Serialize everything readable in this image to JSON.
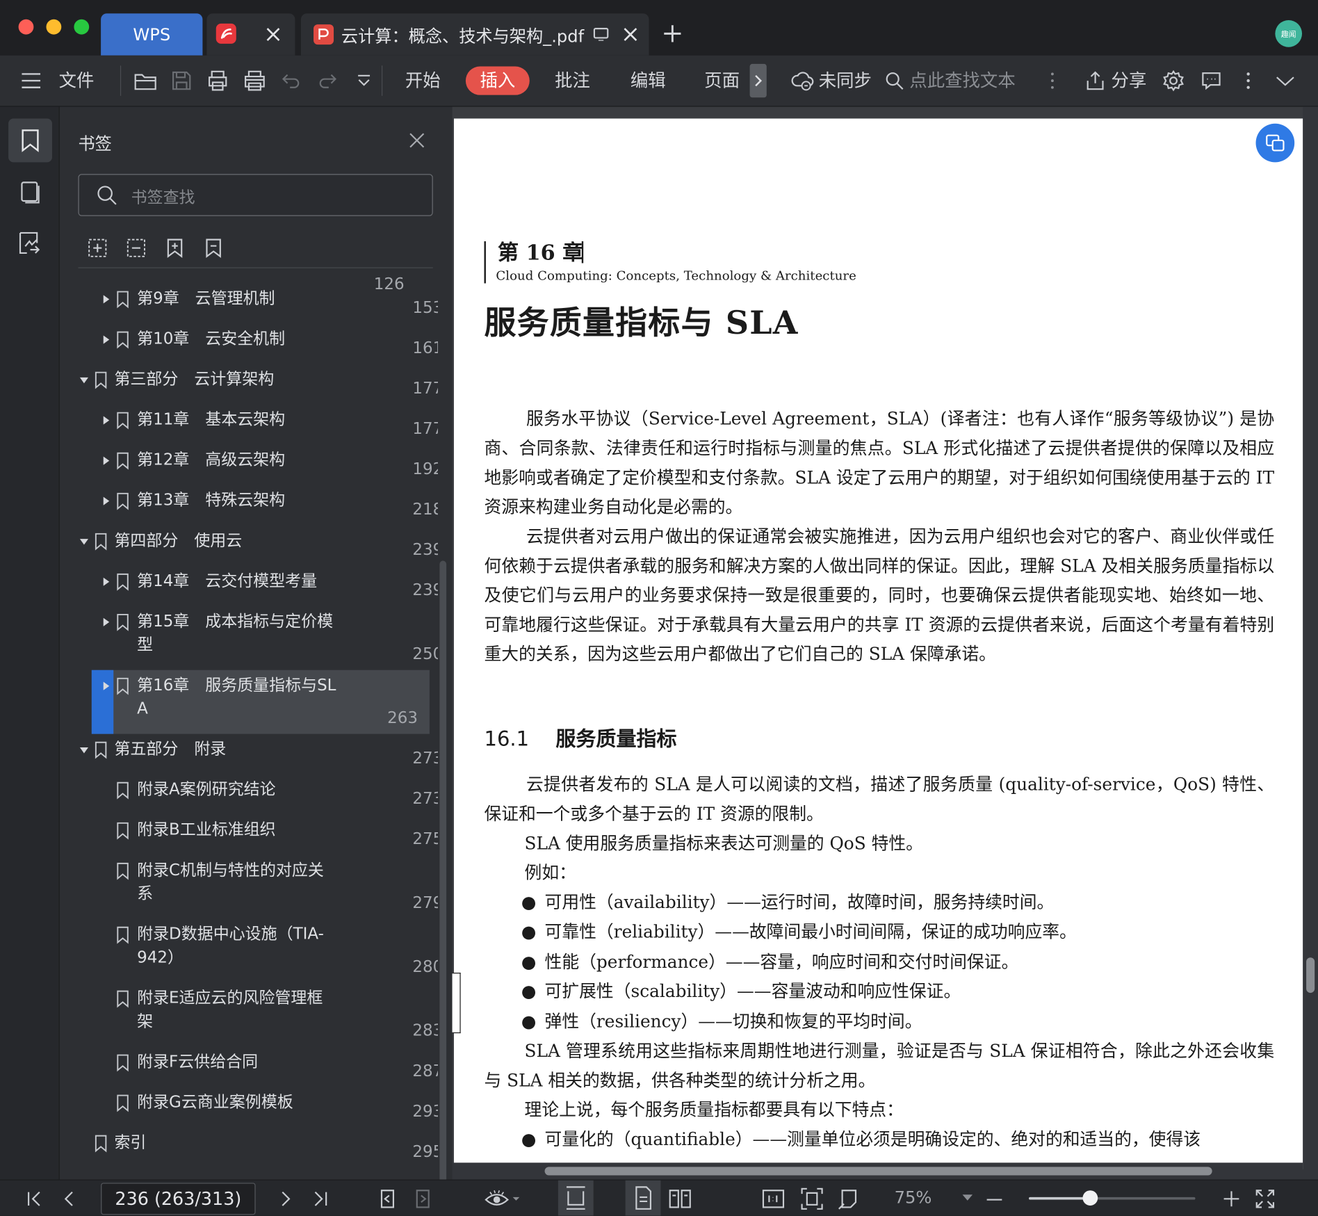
{
  "window": {
    "tabs": [
      {
        "label": "WPS"
      },
      {
        "label": "云计算：概念、技术与架构_.pdf"
      }
    ],
    "avatar_text": "趣闻"
  },
  "toolbar": {
    "file_label": "文件",
    "menu_tabs": [
      "开始",
      "插入",
      "批注",
      "编辑",
      "页面"
    ],
    "active_tab": "插入",
    "sync_label": "未同步",
    "search_placeholder": "点此查找文本",
    "share_label": "分享"
  },
  "sidebar": {
    "title": "书签",
    "search_placeholder": "书签查找",
    "partial_top_page": "126",
    "bookmarks": [
      {
        "label": "第9章　云管理机制",
        "page": "153"
      },
      {
        "label": "第10章　云安全机制",
        "page": "161"
      },
      {
        "label": "第三部分　云计算架构",
        "page": "177"
      },
      {
        "label": "第11章　基本云架构",
        "page": "177"
      },
      {
        "label": "第12章　高级云架构",
        "page": "192"
      },
      {
        "label": "第13章　特殊云架构",
        "page": "218"
      },
      {
        "label": "第四部分　使用云",
        "page": "239"
      },
      {
        "label": "第14章　云交付模型考量",
        "page": "239"
      },
      {
        "label_line1": "第15章　成本指标与定价模",
        "label_line2": "型",
        "page": "250"
      },
      {
        "label_line1": "第16章　服务质量指标与SL",
        "label_line2": "A",
        "page": "263"
      },
      {
        "label": "第五部分　附录",
        "page": "273"
      },
      {
        "label": "附录A案例研究结论",
        "page": "273"
      },
      {
        "label": "附录B工业标准组织",
        "page": "275"
      },
      {
        "label_line1": "附录C机制与特性的对应关",
        "label_line2": "系",
        "page": "279"
      },
      {
        "label_line1": "附录D数据中心设施（TIA-",
        "label_line2": "942）",
        "page": "280"
      },
      {
        "label_line1": "附录E适应云的风险管理框",
        "label_line2": "架",
        "page": "283"
      },
      {
        "label": "附录F云供给合同",
        "page": "287"
      },
      {
        "label": "附录G云商业案例模板",
        "page": "293"
      },
      {
        "label": "索引",
        "page": "295"
      }
    ]
  },
  "document": {
    "chapter_label": "第 16 章",
    "book_subtitle": "Cloud Computing: Concepts, Technology & Architecture",
    "chapter_title": "服务质量指标与 SLA",
    "p1": "服务水平协议（Service-Level Agreement，SLA）(译者注：也有人译作“服务等级协议”) 是协商、合同条款、法律责任和运行时指标与测量的焦点。SLA 形式化描述了云提供者提供的保障以及相应地影响或者确定了定价模型和支付条款。SLA 设定了云用户的期望，对于组织如何围绕使用基于云的 IT 资源来构建业务自动化是必需的。",
    "p2": "云提供者对云用户做出的保证通常会被实施推进，因为云用户组织也会对它的客户、商业伙伴或任何依赖于云提供者承载的服务和解决方案的人做出同样的保证。因此，理解 SLA 及相关服务质量指标以及使它们与云用户的业务要求保持一致是很重要的，同时，也要确保云提供者能现实地、始终如一地、可靠地履行这些保证。对于承载具有大量云用户的共享 IT 资源的云提供者来说，后面这个考量有着特别重大的关系，因为这些云用户都做出了它们自己的 SLA 保障承诺。",
    "section_number": "16.1",
    "section_title": "服务质量指标",
    "p3": "云提供者发布的 SLA 是人可以阅读的文档，描述了服务质量 (quality-of-service，QoS) 特性、保证和一个或多个基于云的 IT 资源的限制。",
    "p4": "SLA 使用服务质量指标来表达可测量的 QoS 特性。",
    "p5": "例如：",
    "bullets": [
      "可用性（availability）——运行时间，故障时间，服务持续时间。",
      "可靠性（reliability）——故障间最小时间间隔，保证的成功响应率。",
      "性能（performance）——容量，响应时间和交付时间保证。",
      "可扩展性（scalability）——容量波动和响应性保证。",
      "弹性（resiliency）——切换和恢复的平均时间。"
    ],
    "p6": "SLA 管理系统用这些指标来周期性地进行测量，验证是否与 SLA 保证相符合，除此之外还会收集与 SLA 相关的数据，供各种类型的统计分析之用。",
    "p7": "理论上说，每个服务质量指标都要具有以下特点：",
    "bullet_last": "可量化的（quantifiable）——测量单位必须是明确设定的、绝对的和适当的，使得该"
  },
  "statusbar": {
    "page_indicator": "236 (263/313)",
    "zoom": "75%",
    "zoom_level": 0.37
  }
}
